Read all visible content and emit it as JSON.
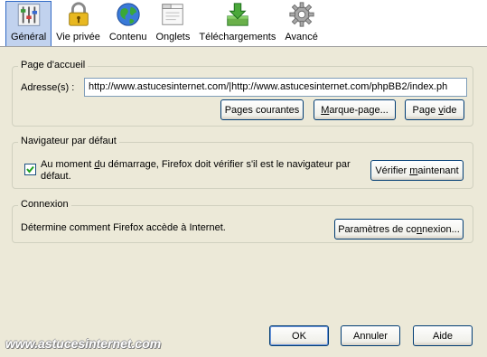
{
  "toolbar": {
    "items": [
      {
        "label": "Général",
        "icon": "sliders-icon",
        "selected": true
      },
      {
        "label": "Vie privée",
        "icon": "padlock-icon",
        "selected": false
      },
      {
        "label": "Contenu",
        "icon": "globe-icon",
        "selected": false
      },
      {
        "label": "Onglets",
        "icon": "window-tabs-icon",
        "selected": false
      },
      {
        "label": "Téléchargements",
        "icon": "download-icon",
        "selected": false
      },
      {
        "label": "Avancé",
        "icon": "gear-icon",
        "selected": false
      }
    ]
  },
  "homepage": {
    "title": "Page d'accueil",
    "address_label": "Adresse(s) :",
    "address_value": "http://www.astucesinternet.com/|http://www.astucesinternet.com/phpBB2/index.ph",
    "btn_current": "Pages courantes",
    "btn_bookmark": "Marque-page...",
    "btn_blank": "Page vide"
  },
  "default_browser": {
    "title": "Navigateur par défaut",
    "checkbox_checked": true,
    "checkbox_text_1": "Au moment du démarrage, Firefox doit vérifier s'il est le navigateur par",
    "checkbox_text_2": "défaut.",
    "btn_check_now": "Vérifier maintenant"
  },
  "connection": {
    "title": "Connexion",
    "description": "Détermine comment Firefox accède à Internet.",
    "btn_settings": "Paramètres de connexion..."
  },
  "footer": {
    "btn_ok": "OK",
    "btn_cancel": "Annuler",
    "btn_help": "Aide"
  },
  "watermark": "www.astucesinternet.com",
  "colors": {
    "dialog_bg": "#ece9d8",
    "selected_tab_bg": "#c1d2ee",
    "button_border": "#003c74"
  }
}
